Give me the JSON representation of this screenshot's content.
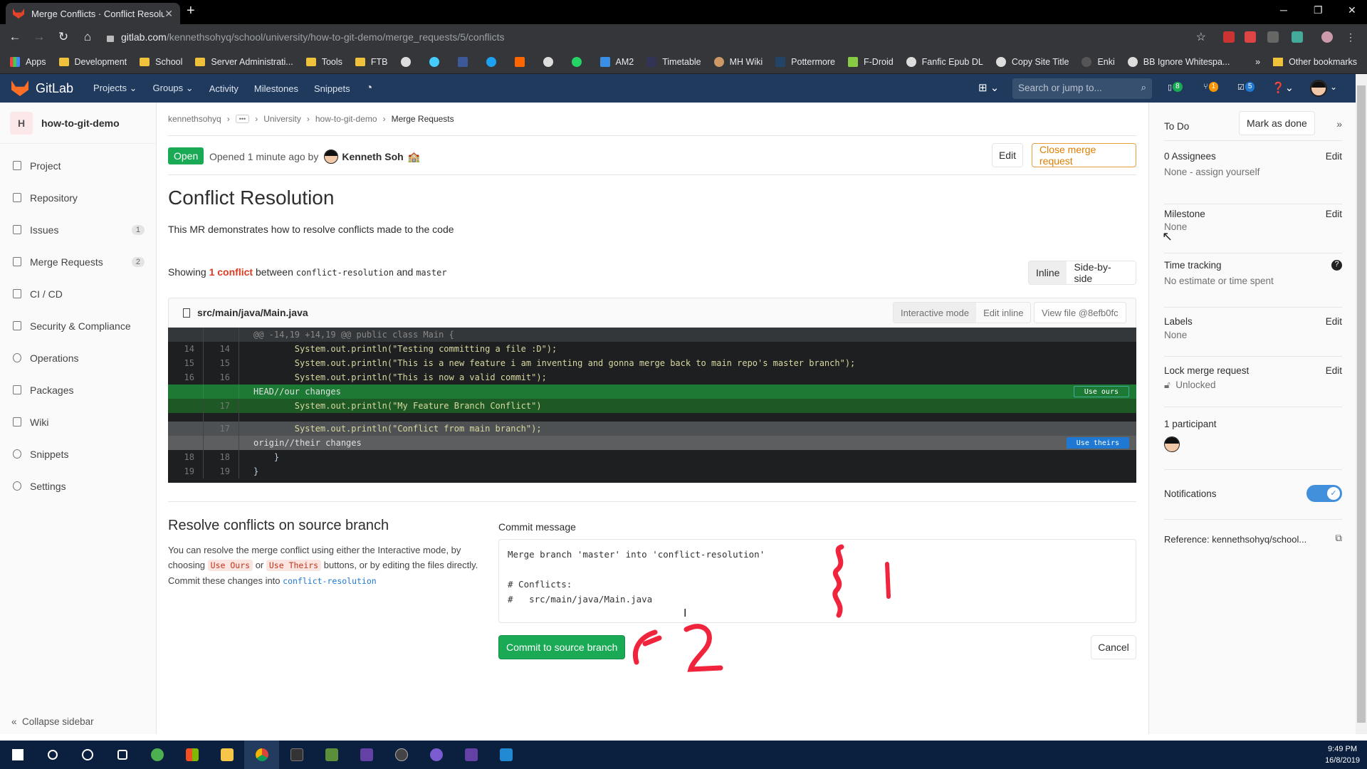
{
  "browser": {
    "tab_title": "Merge Conflicts · Conflict Resolut",
    "url_host": "gitlab.com",
    "url_path": "/kennethsohyq/school/university/how-to-git-demo/merge_requests/5/conflicts",
    "bookmarks": [
      "Apps",
      "Development",
      "School",
      "Server Administrati...",
      "Tools",
      "FTB",
      "",
      "",
      "",
      "",
      "",
      "",
      "",
      "AM2",
      "Timetable",
      "MH Wiki",
      "Pottermore",
      "F-Droid",
      "Fanfic Epub DL",
      "Copy Site Title",
      "Enki",
      "BB Ignore Whitespa..."
    ],
    "other_bookmarks": "Other bookmarks"
  },
  "gitlab_nav": {
    "brand": "GitLab",
    "items": [
      "Projects",
      "Groups",
      "Activity",
      "Milestones",
      "Snippets"
    ],
    "search_placeholder": "Search or jump to...",
    "issues_count": "8",
    "mr_count": "1",
    "todo_count": "5"
  },
  "sidebar": {
    "project_initial": "H",
    "project_name": "how-to-git-demo",
    "items": [
      {
        "label": "Project"
      },
      {
        "label": "Repository"
      },
      {
        "label": "Issues",
        "count": "1"
      },
      {
        "label": "Merge Requests",
        "count": "2"
      },
      {
        "label": "CI / CD"
      },
      {
        "label": "Security & Compliance"
      },
      {
        "label": "Operations"
      },
      {
        "label": "Packages"
      },
      {
        "label": "Wiki"
      },
      {
        "label": "Snippets"
      },
      {
        "label": "Settings"
      }
    ],
    "collapse": "Collapse sidebar"
  },
  "breadcrumb": [
    "kennethsohyq",
    "University",
    "how-to-git-demo",
    "Merge Requests"
  ],
  "mr": {
    "status": "Open",
    "opened_text": "Opened 1 minute ago by",
    "author": "Kenneth Soh",
    "edit": "Edit",
    "close": "Close merge request",
    "title": "Conflict Resolution",
    "description": "This MR demonstrates how to resolve conflicts made to the code",
    "showing_prefix": "Showing",
    "conflict_count": "1 conflict",
    "between": "between",
    "source_branch": "conflict-resolution",
    "and": "and",
    "target_branch": "master",
    "view_inline": "Inline",
    "view_side": "Side-by-side"
  },
  "file": {
    "path": "src/main/java/Main.java",
    "interactive": "Interactive mode",
    "edit_inline": "Edit inline",
    "view_file": "View file @8efb0fc",
    "hunk": "@@ -14,19 +14,19 @@ public class Main {",
    "lines": [
      {
        "old": "14",
        "new": "14",
        "code": "        System.out.println(\"Testing committing a file :D\");"
      },
      {
        "old": "15",
        "new": "15",
        "code": "        System.out.println(\"This is a new feature i am inventing and gonna merge back to main repo's master branch\");"
      },
      {
        "old": "16",
        "new": "16",
        "code": "        System.out.println(\"This is now a valid commit\");"
      }
    ],
    "head_label": "HEAD//our changes",
    "use_ours": "Use ours",
    "ours_line": {
      "old": "",
      "new": "17",
      "code": "        System.out.println(\"My Feature Branch Conflict\")"
    },
    "theirs_line": {
      "old": "",
      "new": "17",
      "code": "        System.out.println(\"Conflict from main branch\");"
    },
    "origin_label": "origin//their changes",
    "use_theirs": "Use theirs",
    "tail": [
      {
        "old": "18",
        "new": "18",
        "code": "    }"
      },
      {
        "old": "19",
        "new": "19",
        "code": "}"
      }
    ]
  },
  "resolve": {
    "title": "Resolve conflicts on source branch",
    "desc1": "You can resolve the merge conflict using either the Interactive mode, by choosing",
    "use_ours": "Use Ours",
    "or": "or",
    "use_theirs": "Use Theirs",
    "desc2": "buttons, or by editing the files directly. Commit these changes into",
    "branch": "conflict-resolution",
    "commit_label": "Commit message",
    "commit_message": "Merge branch 'master' into 'conflict-resolution'\n\n# Conflicts:\n#   src/main/java/Main.java",
    "commit_button": "Commit to source branch",
    "cancel": "Cancel"
  },
  "right_sidebar": {
    "todo": "To Do",
    "mark_done": "Mark as done",
    "assignees": "0 Assignees",
    "assignees_val": "None - assign yourself",
    "milestone": "Milestone",
    "milestone_val": "None",
    "time_tracking": "Time tracking",
    "time_val": "No estimate or time spent",
    "labels": "Labels",
    "labels_val": "None",
    "lock": "Lock merge request",
    "lock_val": "Unlocked",
    "participants": "1 participant",
    "notifications": "Notifications",
    "notifications_on": true,
    "reference": "Reference: kennethsohyq/school...",
    "edit": "Edit"
  },
  "annotations": {
    "one": "1",
    "two": "2"
  },
  "taskbar": {
    "time": "9:49 PM",
    "date": "16/8/2019"
  }
}
